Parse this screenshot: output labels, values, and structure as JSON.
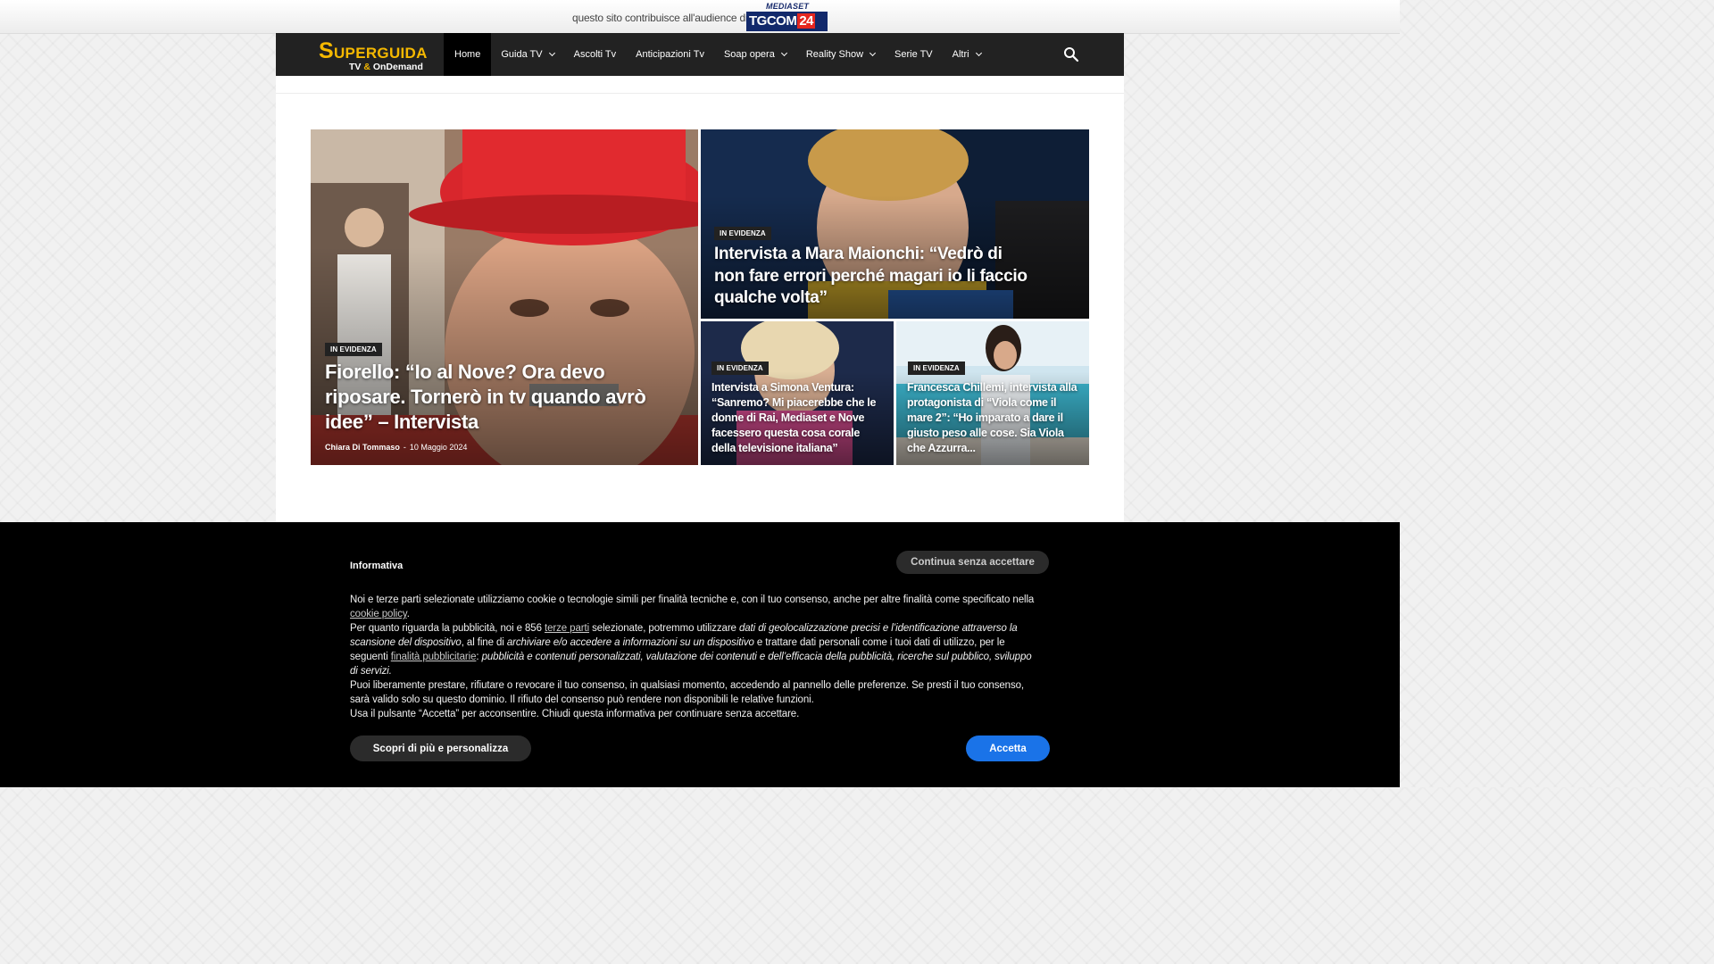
{
  "topbar": {
    "text": "questo sito contribuisce all'audience di",
    "partner_small": "MEDIASET",
    "partner_main": "TGCOM",
    "partner_num": "24"
  },
  "logo": {
    "main_first": "S",
    "main_rest": "UPERGUIDA",
    "sub_a": "TV ",
    "sub_amp": "&",
    "sub_b": " OnDemand"
  },
  "nav": {
    "items": [
      {
        "label": "Home",
        "active": true,
        "dropdown": false
      },
      {
        "label": "Guida TV",
        "dropdown": true
      },
      {
        "label": "Ascolti Tv",
        "dropdown": false
      },
      {
        "label": "Anticipazioni Tv",
        "dropdown": false
      },
      {
        "label": "Soap opera",
        "dropdown": true
      },
      {
        "label": "Reality Show",
        "dropdown": true
      },
      {
        "label": "Serie TV",
        "dropdown": false
      },
      {
        "label": "Altri",
        "dropdown": true
      }
    ],
    "search_icon": "search-icon"
  },
  "articles": {
    "main": {
      "badge": "IN EVIDENZA",
      "title": "Fiorello: “Io al Nove? Ora devo riposare. Tornerò in tv quando avrò idee” – Intervista",
      "author": "Chiara Di Tommaso",
      "sep": "-",
      "date": "10 Maggio 2024"
    },
    "top_right": {
      "badge": "IN EVIDENZA",
      "title": "Intervista a Mara Maionchi: “Vedrò di non fare errori perché magari io li faccio qualche volta”"
    },
    "bottom_left": {
      "badge": "IN EVIDENZA",
      "title": "Intervista a Simona Ventura: “Sanremo? Mi piacerebbe che le donne di Rai, Mediaset e Nove facessero questa cosa corale della televisione italiana”"
    },
    "bottom_right": {
      "badge": "IN EVIDENZA",
      "title": "Francesca Chillemi, intervista alla protagonista di “Viola come il mare 2”: “Ho imparato a dare il giusto peso alle cose. Sia Viola che Azzurra..."
    }
  },
  "cookie": {
    "title": "Informativa",
    "continue_label": "Continua senza accettare",
    "p1_a": "Noi e terze parti selezionate utilizziamo cookie o tecnologie simili per finalità tecniche e, con il tuo consenso, anche per altre finalità come specificato nella ",
    "p1_link": "cookie policy",
    "p1_b": ".",
    "p2_a": "Per quanto riguarda la pubblicità, noi e 856 ",
    "p2_link1": "terze parti",
    "p2_b": " selezionate, potremmo utilizzare ",
    "p2_i1": "dati di geolocalizzazione precisi e l’identificazione attraverso la scansione del dispositivo",
    "p2_c": ", al fine di ",
    "p2_i2": "archiviare e/o accedere a informazioni su un dispositivo",
    "p2_d": " e trattare dati personali come i tuoi dati di utilizzo, per le seguenti ",
    "p2_link2": "finalità pubblicitarie",
    "p2_e": ": ",
    "p2_i3": "pubblicità e contenuti personalizzati, valutazione dei contenuti e dell’efficacia della pubblicità, ricerche sul pubblico, sviluppo di servizi.",
    "p3": "Puoi liberamente prestare, rifiutare o revocare il tuo consenso, in qualsiasi momento, accedendo al pannello delle preferenze. Se presti il tuo consenso, sarà valido solo su questo dominio. Il rifiuto del consenso può rendere non disponibili le relative funzioni.",
    "p4": "Usa il pulsante “Accetta” per acconsentire. Chiudi questa informativa per continuare senza accettare.",
    "more_label": "Scopri di più e personalizza",
    "accept_label": "Accetta",
    "accept_color": "#1a73e8"
  }
}
